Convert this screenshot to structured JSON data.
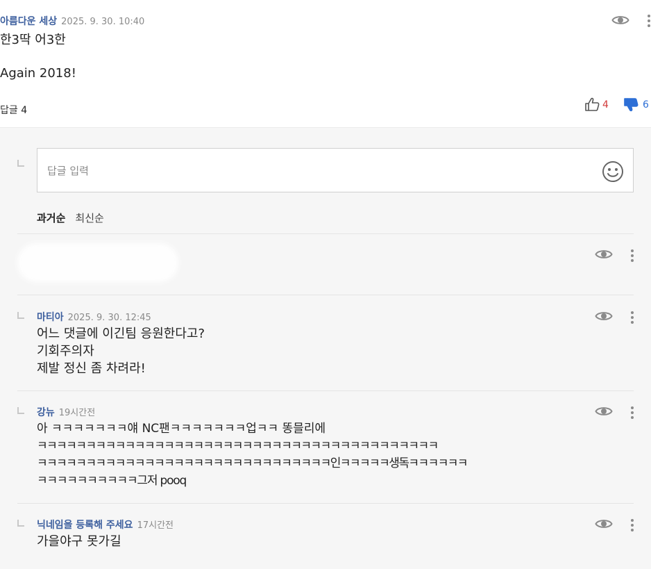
{
  "top_comment": {
    "author": "아름다운 세상",
    "date": "2025. 9. 30. 10:40",
    "lines": [
      "한3딱 어3한",
      "",
      "Again 2018!"
    ],
    "reply_label": "답글",
    "reply_count": "4",
    "likes": "4",
    "dislikes": "6"
  },
  "reply_input": {
    "placeholder": "답글 입력"
  },
  "sort": {
    "oldest": "과거순",
    "newest": "최신순"
  },
  "replies": [
    {
      "author": "마티아",
      "date": "2025. 9. 30. 12:45",
      "lines": [
        "어느 댓글에 이긴팀 응원한다고?",
        "기회주의자",
        "제발 정신 좀 차려라!"
      ]
    },
    {
      "author": "강뉴",
      "date": "19시간전",
      "lines": [
        "아 ㅋㅋㅋㅋㅋㅋㅋ얘 NC팬ㅋㅋㅋㅋㅋㅋㅋ업ㅋㅋ 똥믈리에",
        "ㅋㅋㅋㅋㅋㅋㅋㅋㅋㅋㅋㅋㅋㅋㅋㅋㅋㅋㅋㅋㅋㅋㅋㅋㅋㅋㅋㅋㅋㅋㅋㅋㅋㅋㅋㅋㅋㅋㅋㅋㅋ",
        "ㅋㅋㅋㅋㅋㅋㅋㅋㅋㅋㅋㅋㅋㅋㅋㅋㅋㅋㅋㅋㅋㅋㅋㅋㅋㅋㅋㅋㅋㅋ인ㅋㅋㅋㅋㅋ생독ㅋㅋㅋㅋㅋㅋ",
        "ㅋㅋㅋㅋㅋㅋㅋㅋㅋㅋ그저 pooq"
      ]
    },
    {
      "author": "닉네임을 등록해 주세요",
      "date": "17시간전",
      "lines": [
        "가을야구 못가길"
      ]
    }
  ],
  "icons": {
    "view": "eye-icon",
    "more": "kebab-menu-icon",
    "like": "thumbs-up-icon",
    "dislike": "thumbs-down-icon",
    "emoji": "smiley-icon",
    "reply_arrow": "reply-arrow-icon"
  },
  "colors": {
    "author": "#3d5f9e",
    "like": "#d13b3b",
    "dislike": "#2d6fd6",
    "reply_bg": "#f6f6f6"
  }
}
